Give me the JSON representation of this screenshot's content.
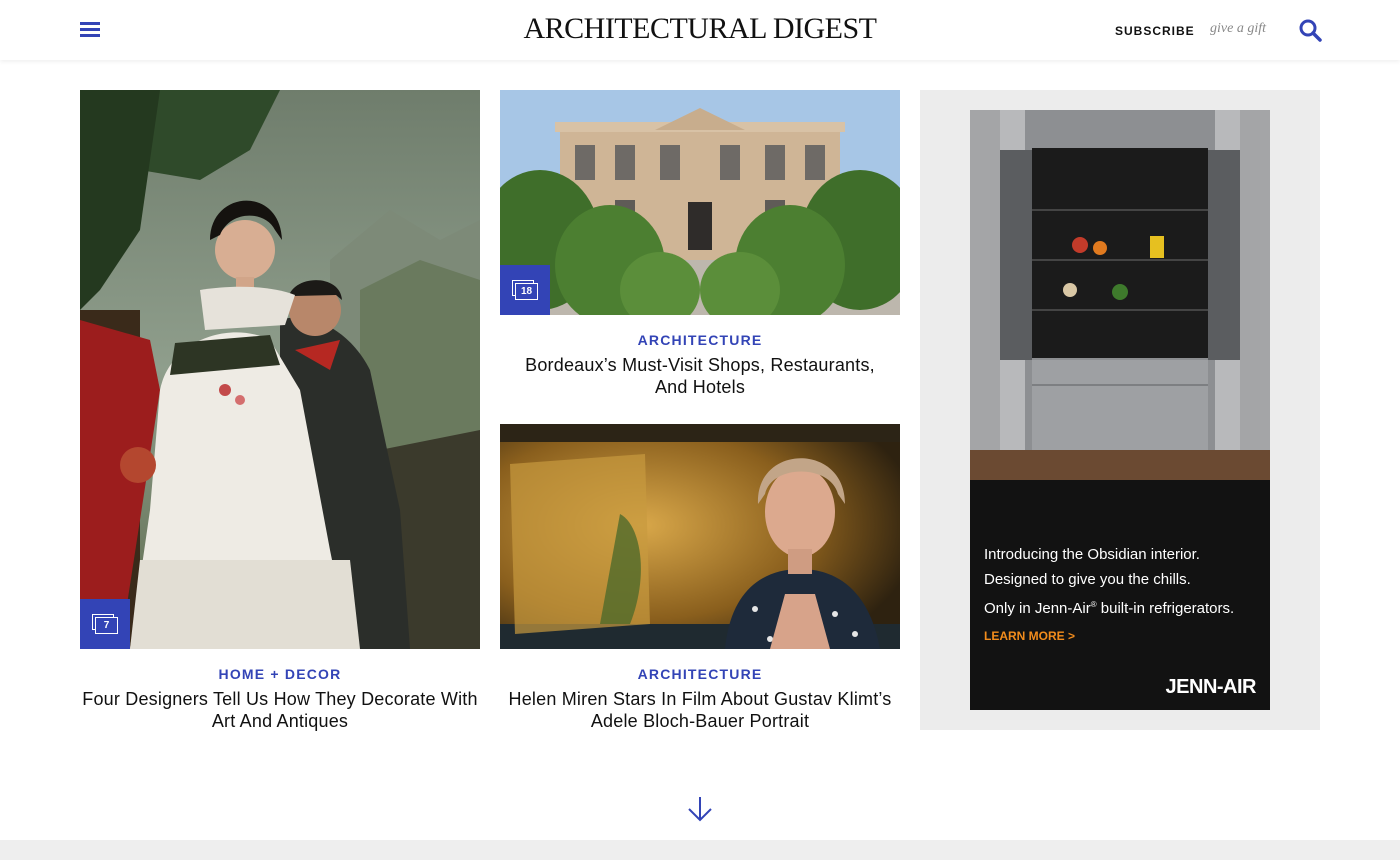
{
  "header": {
    "logo": "ARCHITECTURAL DIGEST",
    "subscribe_label": "SUBSCRIBE",
    "gift_label": "give a gift",
    "menu_icon": "hamburger-menu-icon",
    "search_icon": "search-icon"
  },
  "colors": {
    "accent": "#3344b6",
    "ad_cta": "#f28c1c"
  },
  "cards": [
    {
      "category": "HOME + DECOR",
      "title": "Four Designers Tell Us How They Decorate With Art And Antiques",
      "gallery_count": "7"
    },
    {
      "category": "ARCHITECTURE",
      "title": "Bordeaux’s Must-Visit Shops, Restaurants, And Hotels",
      "gallery_count": "18"
    },
    {
      "category": "ARCHITECTURE",
      "title": "Helen Miren Stars In Film About Gustav Klimt’s Adele Bloch-Bauer Portrait"
    }
  ],
  "ad": {
    "line1": "Introducing the Obsidian interior.",
    "line2": "Designed to give you the chills.",
    "line3_pre": "Only in Jenn-Air",
    "line3_mark": "®",
    "line3_post": " built-in refrigerators.",
    "cta": "LEARN MORE >",
    "brand": "JENN-AIR"
  },
  "load_more_icon": "arrow-down-icon"
}
